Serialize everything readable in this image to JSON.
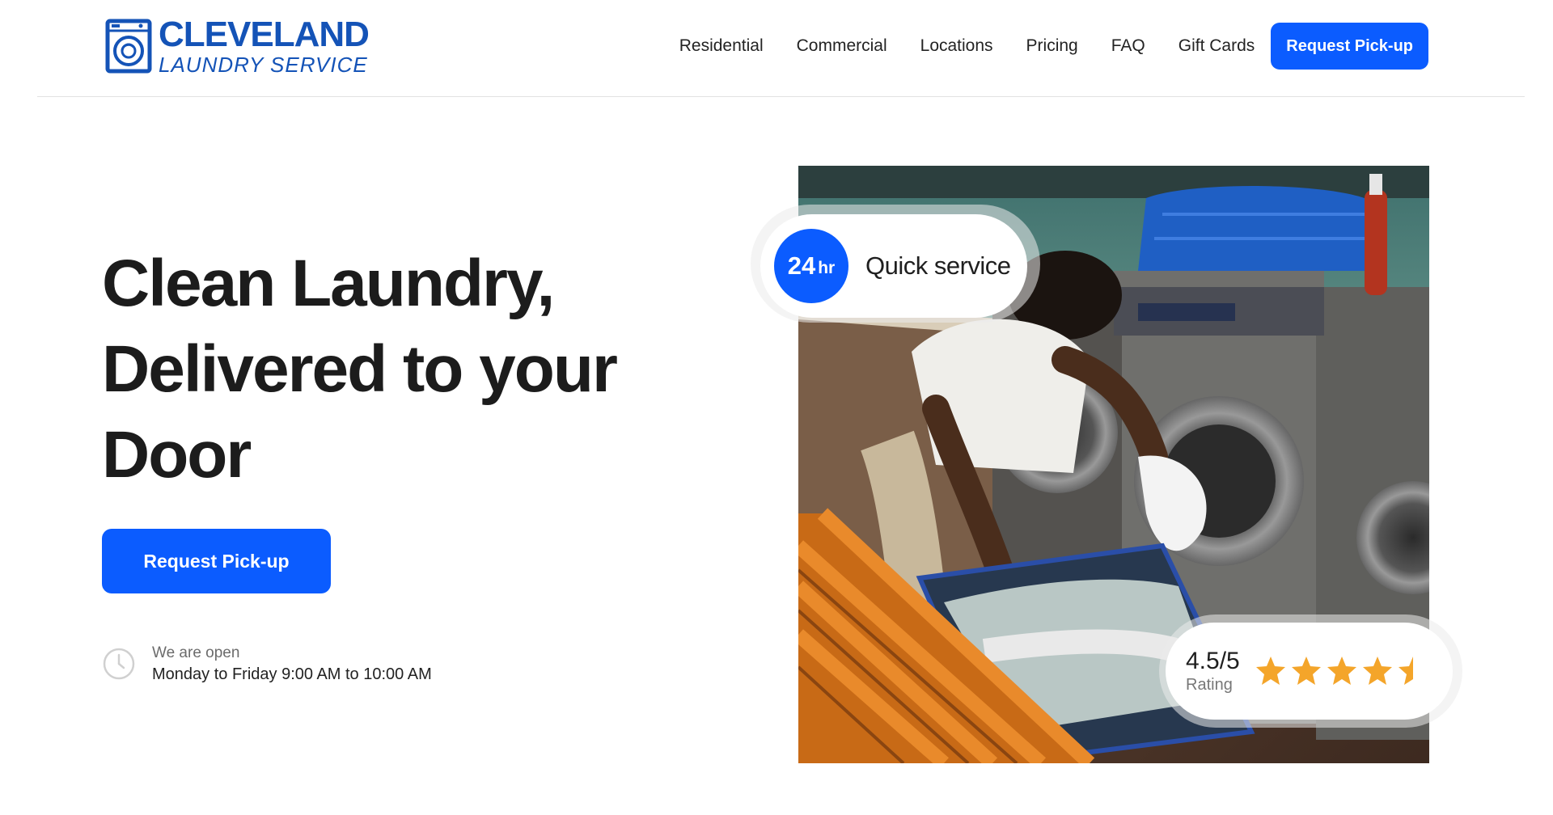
{
  "header": {
    "logo": {
      "line1": "CLEVELAND",
      "line2": "LAUNDRY SERVICE",
      "icon": "washing-machine-icon"
    },
    "nav": [
      {
        "label": "Residential"
      },
      {
        "label": "Commercial"
      },
      {
        "label": "Locations"
      },
      {
        "label": "Pricing"
      },
      {
        "label": "FAQ"
      },
      {
        "label": "Gift Cards"
      }
    ],
    "cta_label": "Request Pick-up"
  },
  "hero": {
    "title_lines": [
      "Clean Laundry,",
      "Delivered to your",
      "Door"
    ],
    "cta_label": "Request Pick-up",
    "hours": {
      "icon": "clock-icon",
      "label": "We are open",
      "value": "Monday to Friday 9:00 AM to  10:00  AM"
    },
    "image_alt_icon": "laundromat-photo",
    "service_badge": {
      "number": "24",
      "unit": "hr",
      "label": "Quick service"
    },
    "rating_badge": {
      "value": "4.5/5",
      "label": "Rating",
      "stars": 4.5,
      "star_color": "#f4a52a"
    }
  },
  "colors": {
    "brand_blue": "#1453b7",
    "accent": "#0b5cff"
  }
}
